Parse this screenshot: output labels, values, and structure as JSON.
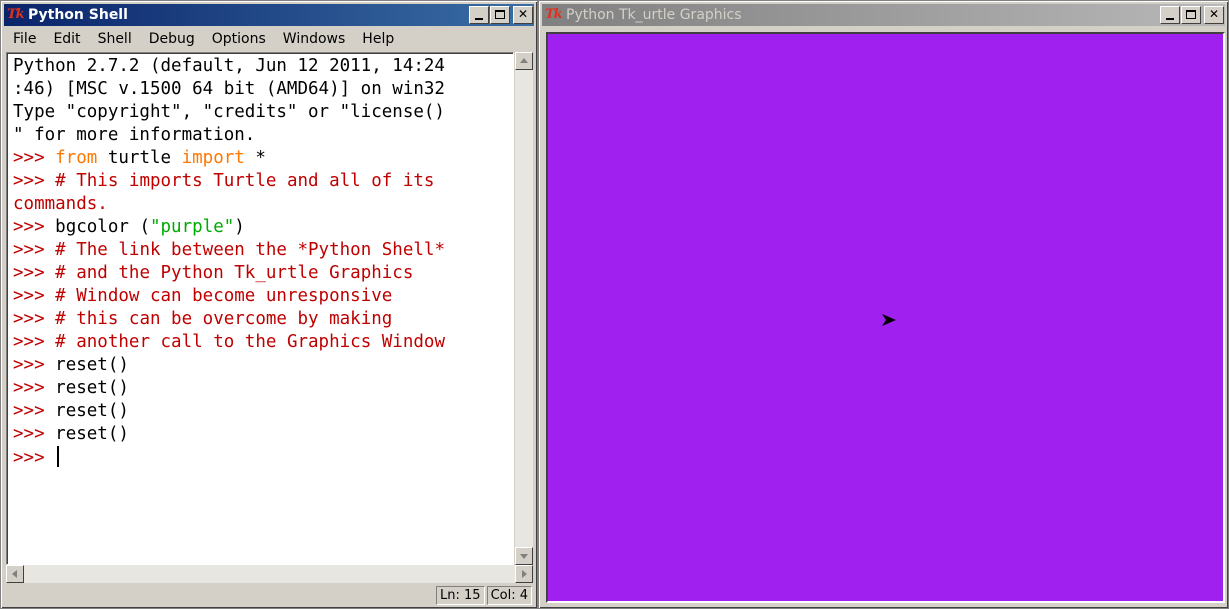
{
  "shell": {
    "title": "Python Shell",
    "menu": [
      "File",
      "Edit",
      "Shell",
      "Debug",
      "Options",
      "Windows",
      "Help"
    ],
    "lines": [
      [
        {
          "t": "Python 2.7.2 (default, Jun 12 2011, 14:24",
          "c": "normal"
        }
      ],
      [
        {
          "t": ":46) [MSC v.1500 64 bit (AMD64)] on win32",
          "c": "normal"
        }
      ],
      [
        {
          "t": "Type \"copyright\", \"credits\" or \"license()",
          "c": "normal"
        }
      ],
      [
        {
          "t": "\" for more information.",
          "c": "normal"
        }
      ],
      [
        {
          "t": ">>> ",
          "c": "prompt"
        },
        {
          "t": "from",
          "c": "keyword"
        },
        {
          "t": " turtle ",
          "c": "normal"
        },
        {
          "t": "import",
          "c": "keyword"
        },
        {
          "t": " *",
          "c": "normal"
        }
      ],
      [
        {
          "t": ">>> ",
          "c": "prompt"
        },
        {
          "t": "# This imports Turtle and all of its",
          "c": "comment"
        }
      ],
      [
        {
          "t": "commands.",
          "c": "comment"
        }
      ],
      [
        {
          "t": ">>> ",
          "c": "prompt"
        },
        {
          "t": "bgcolor (",
          "c": "normal"
        },
        {
          "t": "\"purple\"",
          "c": "string"
        },
        {
          "t": ")",
          "c": "normal"
        }
      ],
      [
        {
          "t": ">>> ",
          "c": "prompt"
        },
        {
          "t": "# The link between the *Python Shell*",
          "c": "comment"
        }
      ],
      [
        {
          "t": ">>> ",
          "c": "prompt"
        },
        {
          "t": "# and the Python Tk_urtle Graphics",
          "c": "comment"
        }
      ],
      [
        {
          "t": ">>> ",
          "c": "prompt"
        },
        {
          "t": "# Window can become unresponsive",
          "c": "comment"
        }
      ],
      [
        {
          "t": ">>> ",
          "c": "prompt"
        },
        {
          "t": "# this can be overcome by making",
          "c": "comment"
        }
      ],
      [
        {
          "t": ">>> ",
          "c": "prompt"
        },
        {
          "t": "# another call to the Graphics Window",
          "c": "comment"
        }
      ],
      [
        {
          "t": ">>> ",
          "c": "prompt"
        },
        {
          "t": "reset()",
          "c": "normal"
        }
      ],
      [
        {
          "t": ">>> ",
          "c": "prompt"
        },
        {
          "t": "reset()",
          "c": "normal"
        }
      ],
      [
        {
          "t": ">>> ",
          "c": "prompt"
        },
        {
          "t": "reset()",
          "c": "normal"
        }
      ],
      [
        {
          "t": ">>> ",
          "c": "prompt"
        },
        {
          "t": "reset()",
          "c": "normal"
        }
      ],
      [
        {
          "t": ">>> ",
          "c": "prompt"
        }
      ]
    ],
    "status": {
      "line": "Ln: 15",
      "col": "Col: 4"
    }
  },
  "turtle_window": {
    "title": "Python Tk_urtle Graphics",
    "canvas_color": "#a020f0"
  },
  "icons": {
    "app": "tk-icon"
  },
  "colors": {
    "prompt": "#c00000",
    "keyword": "#ff7700",
    "string": "#00aa00",
    "titlebar_active": "#0a246a"
  }
}
